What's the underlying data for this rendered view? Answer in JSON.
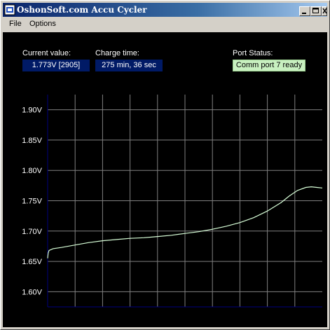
{
  "window": {
    "title": "OshonSoft.com Accu Cycler",
    "icon": "battery-app-icon",
    "controls": [
      "minimize-icon",
      "maximize-icon",
      "close-icon"
    ]
  },
  "menu": {
    "file": "File",
    "options": "Options"
  },
  "readouts": {
    "current_value_label": "Current value:",
    "current_value": "1.773V [2905]",
    "charge_time_label": "Charge time:",
    "charge_time": "275 min, 36 sec",
    "port_status_label": "Port Status:",
    "port_status": "Comm port 7 ready"
  },
  "colors": {
    "plot_background": "#000000",
    "grid": "#808080",
    "axis": "#000080",
    "trace": "#d8ffd8",
    "status_background": "#c8f0c0",
    "value_box": "#001a66"
  },
  "chart_data": {
    "type": "line",
    "title": "",
    "xlabel": "",
    "ylabel": "",
    "ylim": [
      1.575,
      1.925
    ],
    "y_ticks": [
      "1.60V",
      "1.65V",
      "1.70V",
      "1.75V",
      "1.80V",
      "1.85V",
      "1.90V"
    ],
    "y_tick_values": [
      1.6,
      1.65,
      1.7,
      1.75,
      1.8,
      1.85,
      1.9
    ],
    "x_tick_labels": false,
    "x_range": [
      0,
      100
    ],
    "grid": true,
    "series": [
      {
        "values": [
          [
            0,
            1.655
          ],
          [
            0.2,
            1.664
          ],
          [
            0.5,
            1.668
          ],
          [
            2,
            1.671
          ],
          [
            5,
            1.673
          ],
          [
            10,
            1.677
          ],
          [
            15,
            1.681
          ],
          [
            20,
            1.684
          ],
          [
            25,
            1.686
          ],
          [
            30,
            1.688
          ],
          [
            35,
            1.689
          ],
          [
            40,
            1.691
          ],
          [
            45,
            1.693
          ],
          [
            50,
            1.696
          ],
          [
            55,
            1.699
          ],
          [
            60,
            1.703
          ],
          [
            65,
            1.708
          ],
          [
            70,
            1.714
          ],
          [
            75,
            1.722
          ],
          [
            80,
            1.733
          ],
          [
            85,
            1.747
          ],
          [
            88,
            1.758
          ],
          [
            91,
            1.767
          ],
          [
            94,
            1.772
          ],
          [
            96,
            1.773
          ],
          [
            98,
            1.772
          ],
          [
            100,
            1.771
          ]
        ]
      }
    ]
  }
}
